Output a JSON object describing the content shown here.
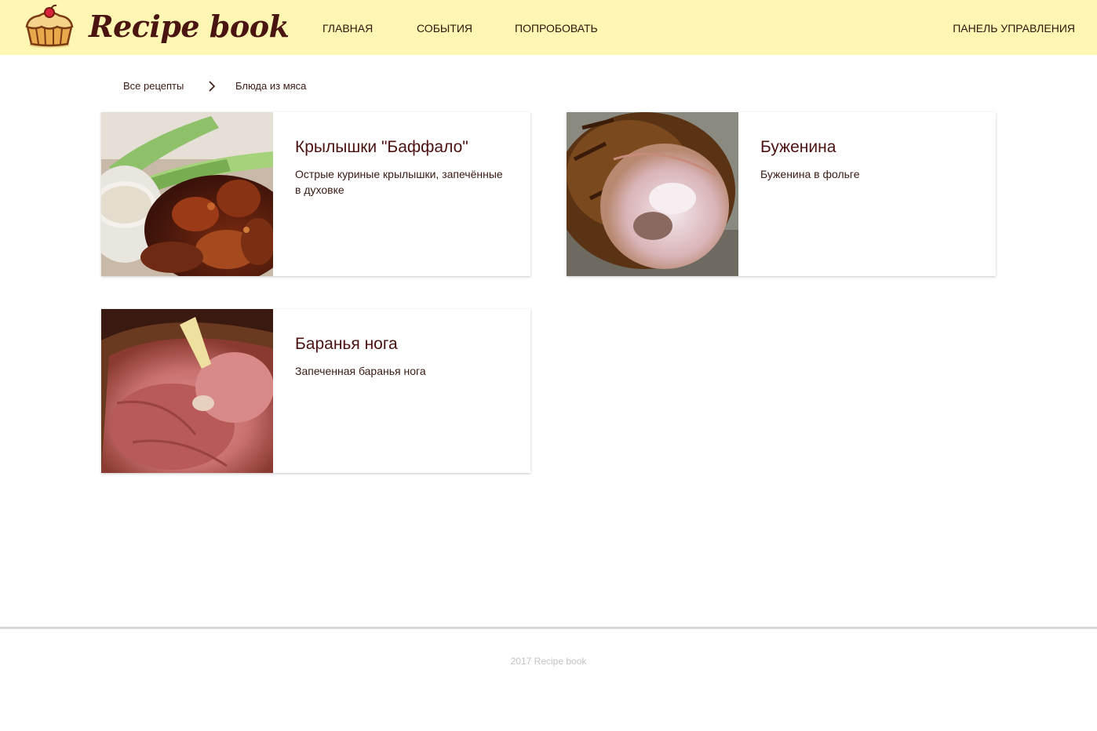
{
  "header": {
    "logo_text": "Recipe book",
    "logo_icon": "cupcake-icon",
    "nav": {
      "home": "ГЛАВНАЯ",
      "events": "СОБЫТИЯ",
      "try": "ПОПРОБОВАТЬ",
      "admin": "ПАНЕЛЬ УПРАВЛЕНИЯ"
    }
  },
  "breadcrumb": {
    "all_recipes": "Все рецепты",
    "separator_icon": "chevron-right-icon",
    "current": "Блюда из мяса"
  },
  "recipes": [
    {
      "title": "Крылышки \"Баффало\"",
      "description": "Острые куриные крылышки, запечённые в духовке",
      "image": "chicken-wings-photo"
    },
    {
      "title": "Буженина",
      "description": "Буженина в фольге",
      "image": "roast-pork-photo"
    },
    {
      "title": "Баранья нога",
      "description": "Запеченная баранья нога",
      "image": "roast-lamb-leg-photo"
    }
  ],
  "footer": {
    "text": "2017 Recipe book"
  },
  "colors": {
    "header_bg": "#fff6b3",
    "title_text": "#4a1210",
    "footer_text": "#c3c3c3",
    "footer_line": "#d8d8d8"
  }
}
